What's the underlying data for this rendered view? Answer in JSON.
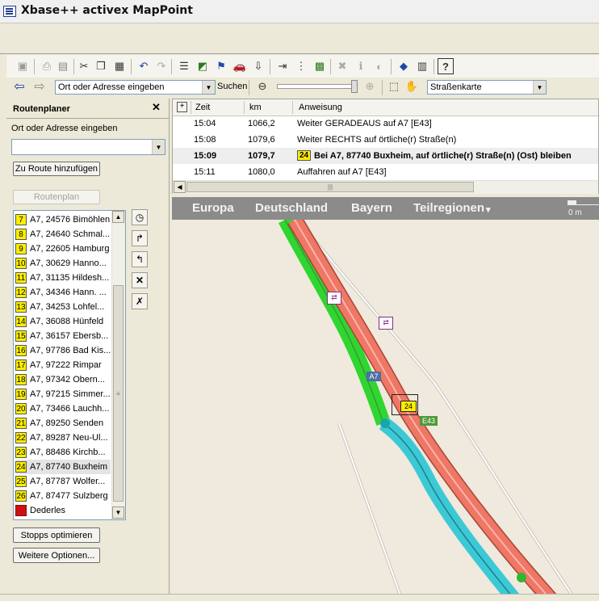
{
  "window": {
    "title": "Xbase++ activex MapPoint"
  },
  "navbar": {
    "location_combo": "Ort oder Adresse eingeben",
    "search_button": "Suchen",
    "map_style": "Straßenkarte"
  },
  "route_panel": {
    "title": "Routenplaner",
    "location_label": "Ort oder Adresse eingeben",
    "location_value": "",
    "add_button": "Zu Route hinzufügen",
    "route_button": "Routenplan",
    "stops": [
      {
        "num": "7",
        "label": "A7, 24576 Bimöhlen"
      },
      {
        "num": "8",
        "label": "A7, 24640 Schmal..."
      },
      {
        "num": "9",
        "label": "A7, 22605 Hamburg"
      },
      {
        "num": "10",
        "label": "A7, 30629 Hanno..."
      },
      {
        "num": "11",
        "label": "A7, 31135 Hildesh..."
      },
      {
        "num": "12",
        "label": "A7, 34346 Hann. ..."
      },
      {
        "num": "13",
        "label": "A7, 34253 Lohfel..."
      },
      {
        "num": "14",
        "label": "A7, 36088 Hünfeld"
      },
      {
        "num": "15",
        "label": "A7, 36157 Ebersb..."
      },
      {
        "num": "16",
        "label": "A7, 97786 Bad Kis..."
      },
      {
        "num": "17",
        "label": "A7, 97222 Rimpar"
      },
      {
        "num": "18",
        "label": "A7, 97342 Obern..."
      },
      {
        "num": "19",
        "label": "A7, 97215 Simmer..."
      },
      {
        "num": "20",
        "label": "A7, 73466 Lauchh..."
      },
      {
        "num": "21",
        "label": "A7, 89250 Senden"
      },
      {
        "num": "22",
        "label": "A7, 89287 Neu-Ul..."
      },
      {
        "num": "23",
        "label": "A7, 88486 Kirchb..."
      },
      {
        "num": "24",
        "label": "A7, 87740 Buxheim"
      },
      {
        "num": "25",
        "label": "A7, 87787 Wolfer..."
      },
      {
        "num": "26",
        "label": "A7, 87477 Sulzberg"
      },
      {
        "num": "",
        "label": "Dederles"
      }
    ],
    "optimize_button": "Stopps optimieren",
    "more_button": "Weitere Optionen..."
  },
  "directions": {
    "headers": {
      "time": "Zeit",
      "km": "km",
      "instruction": "Anweisung"
    },
    "rows": [
      {
        "time": "15:04",
        "km": "1066,2",
        "badge": "",
        "text": "Weiter GERADEAUS auf A7 [E43]"
      },
      {
        "time": "15:08",
        "km": "1079,6",
        "badge": "",
        "text": "Weiter RECHTS auf örtliche(r) Straße(n)"
      },
      {
        "time": "15:09",
        "km": "1079,7",
        "badge": "24",
        "text": "Bei A7, 87740 Buxheim, auf örtliche(r) Straße(n) (Ost) bleiben"
      },
      {
        "time": "15:11",
        "km": "1080,0",
        "badge": "",
        "text": "Auffahren auf A7 [E43]"
      }
    ]
  },
  "map": {
    "breadcrumb": [
      "Europa",
      "Deutschland",
      "Bayern",
      "Teilregionen"
    ],
    "scale_label": "0 m",
    "road_label_a7": "A7",
    "road_label_e43": "E43",
    "pin_label": "24"
  },
  "colors": {
    "route_green": "#2fd62f",
    "route_cyan": "#3cc9d6",
    "highway": "#ee7766",
    "map_bg": "#f0e9dd",
    "map_nav": "#8b8b8b",
    "stop_yellow": "#ffee00",
    "stop_red": "#cc1111"
  }
}
